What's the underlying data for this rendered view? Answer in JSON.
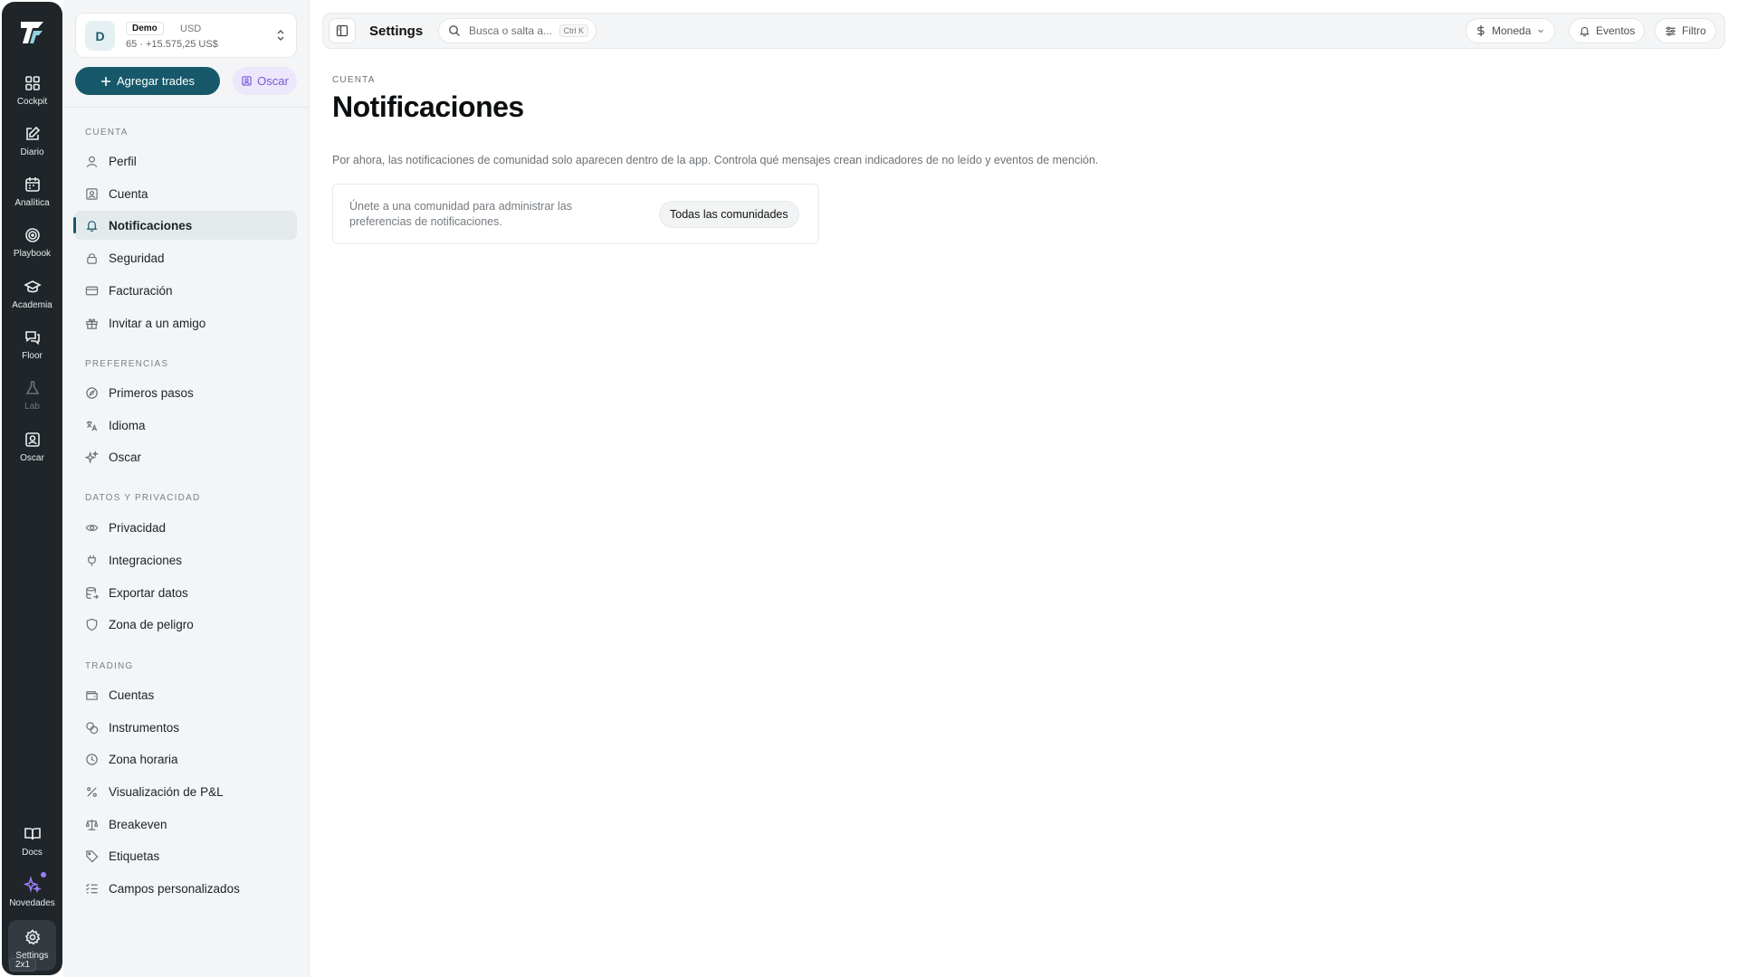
{
  "rail": {
    "items": [
      {
        "label": "Cockpit",
        "icon": "grid-icon"
      },
      {
        "label": "Diario",
        "icon": "edit-icon"
      },
      {
        "label": "Analítica",
        "icon": "calendar-icon"
      },
      {
        "label": "Playbook",
        "icon": "target-icon"
      },
      {
        "label": "Academia",
        "icon": "graduation-cap-icon"
      },
      {
        "label": "Floor",
        "icon": "chat-icon"
      },
      {
        "label": "Lab",
        "icon": "flask-icon"
      },
      {
        "label": "Oscar",
        "icon": "bot-icon"
      }
    ],
    "bottom_items": [
      {
        "label": "Docs",
        "icon": "book-icon"
      },
      {
        "label": "Novedades",
        "icon": "sparkles-icon"
      },
      {
        "label": "Settings",
        "icon": "gear-icon"
      }
    ],
    "shortcut_badge": "2x1"
  },
  "account": {
    "avatar_letter": "D",
    "mode": "Demo",
    "currency": "USD",
    "summary": "65 · +15.575,25 US$"
  },
  "sidebar": {
    "add_trades_label": "Agregar trades",
    "oscar_label": "Oscar",
    "sections": {
      "cuenta": "CUENTA",
      "preferencias": "PREFERENCIAS",
      "datos": "DATOS Y PRIVACIDAD",
      "trading": "TRADING"
    },
    "items": {
      "perfil": "Perfil",
      "cuenta": "Cuenta",
      "notificaciones": "Notificaciones",
      "seguridad": "Seguridad",
      "facturacion": "Facturación",
      "invitar": "Invitar a un amigo",
      "primeros_pasos": "Primeros pasos",
      "idioma": "Idioma",
      "oscar": "Oscar",
      "privacidad": "Privacidad",
      "integraciones": "Integraciones",
      "exportar": "Exportar datos",
      "zona_peligro": "Zona de peligro",
      "cuentas": "Cuentas",
      "instrumentos": "Instrumentos",
      "zona_horaria": "Zona horaria",
      "pnl": "Visualización de P&L",
      "breakeven": "Breakeven",
      "etiquetas": "Etiquetas",
      "campos": "Campos personalizados"
    }
  },
  "topbar": {
    "title": "Settings",
    "search_placeholder": "Busca o salta a...",
    "search_shortcut": "Ctrl K",
    "currency_label": "Moneda",
    "events_label": "Eventos",
    "filter_label": "Filtro"
  },
  "main": {
    "breadcrumb": "CUENTA",
    "title": "Notificaciones",
    "description": "Por ahora, las notificaciones de comunidad solo aparecen dentro de la app. Controla qué mensajes crean indicadores de no leído y eventos de mención.",
    "community_text": "Únete a una comunidad para administrar las preferencias de notificaciones.",
    "community_button": "Todas las comunidades"
  },
  "colors": {
    "accent": "#17596a",
    "rail_bg": "#1f2529",
    "oscar_purple": "#7857d6"
  }
}
